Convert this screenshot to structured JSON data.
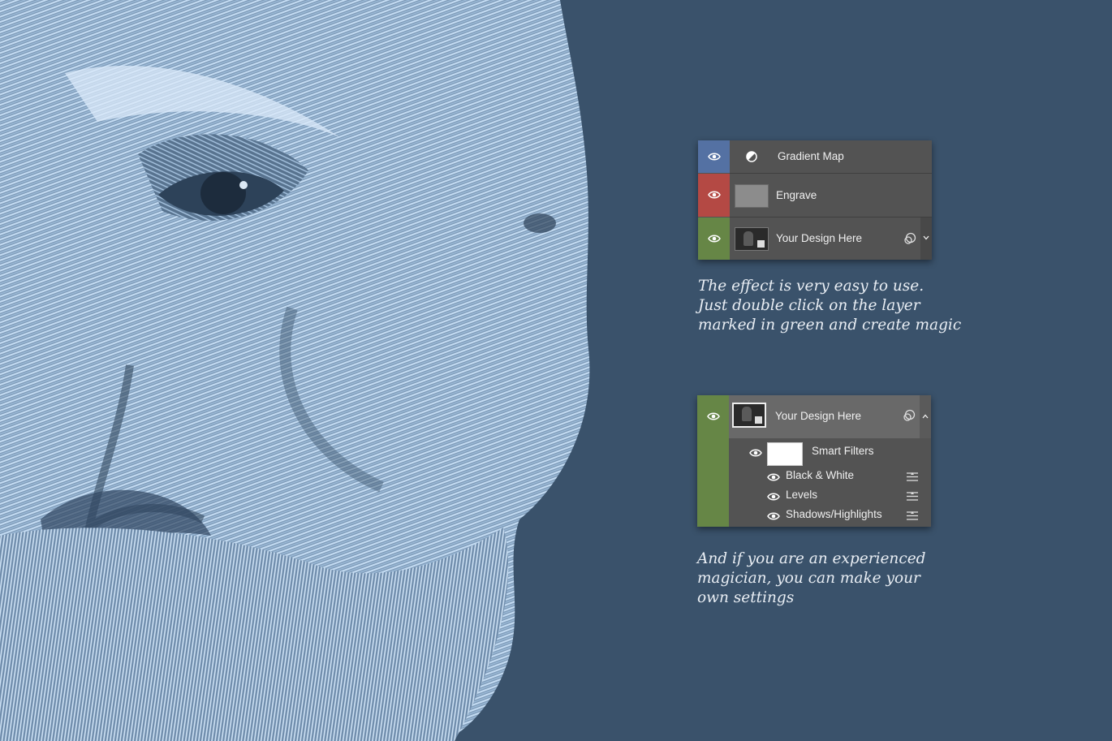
{
  "colors": {
    "background": "#3a526b",
    "engraving": "#b7d3ef",
    "panel": "#535353",
    "blue_tag": "#5471a3",
    "red_tag": "#b44944",
    "green_tag": "#668646"
  },
  "panel_top": {
    "layers": [
      {
        "name": "Gradient Map",
        "icon": "adjustment-circle-icon",
        "color": "blue"
      },
      {
        "name": "Engrave",
        "icon": "gray-thumbnail",
        "color": "red"
      },
      {
        "name": "Your Design Here",
        "icon": "smart-object-thumbnail",
        "color": "green"
      }
    ]
  },
  "caption_1": {
    "line1": "The effect is very easy to use.",
    "line2": "Just double click on the layer",
    "line3": "marked in green and create magic"
  },
  "panel_bottom": {
    "layer_name": "Your Design Here",
    "smart_filters_label": "Smart Filters",
    "filters": [
      "Black & White",
      "Levels",
      "Shadows/Highlights"
    ]
  },
  "caption_2": {
    "line1": "And if you are an experienced",
    "line2": "magician, you can make your",
    "line3": "own settings"
  }
}
